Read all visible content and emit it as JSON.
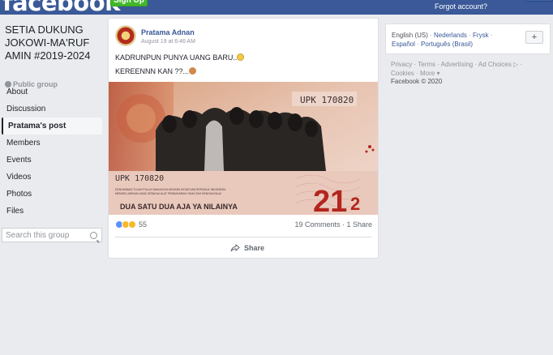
{
  "topbar": {
    "logo": "facebook",
    "signup_label": "Sign Up",
    "forgot_label": "Forgot account?"
  },
  "group": {
    "title": "SETIA DUKUNG JOKOWI-MA'RUF AMIN #2019-2024",
    "privacy": "Public group"
  },
  "nav": {
    "items": [
      {
        "label": "About"
      },
      {
        "label": "Discussion"
      },
      {
        "label": "Pratama's post"
      },
      {
        "label": "Members"
      },
      {
        "label": "Events"
      },
      {
        "label": "Videos"
      },
      {
        "label": "Photos"
      },
      {
        "label": "Files"
      }
    ]
  },
  "search": {
    "placeholder": "Search this group"
  },
  "post": {
    "author": "Pratama Adnan",
    "timestamp": "August 19 at 6:46 AM",
    "line1": "KADRUNPUN PUNYA UANG BARU..",
    "line2": "KEREENNN KAN ??...",
    "image": {
      "serial_top": "UPK 170820",
      "serial_bottom": "UPK 170820",
      "small_text_1": "DENOMINASI TUJUH PULUH MAHALNYA NEGARA KESATUAN REPUBLIK INDONESIA",
      "small_text_2": "MENGELUARKAN UANG SEBAGAI ALAT PEMBAYARAN YANG SAH DENGAN NILAI",
      "caption": "DUA SATU DUA AJA YA NILAINYA",
      "denomination_main": "21",
      "denomination_sub": "2"
    },
    "reaction_count": "55",
    "comments": "19 Comments",
    "shares": "1 Share",
    "share_label": "Share"
  },
  "right": {
    "current_language": "English (US)",
    "languages": [
      "Nederlands",
      "Frysk",
      "Español",
      "Português (Brasil)"
    ],
    "add_language": "+",
    "footer_links": [
      "Privacy",
      "Terms",
      "Advertising",
      "Ad Choices",
      "Cookies",
      "More"
    ],
    "copyright": "Facebook © 2020"
  }
}
